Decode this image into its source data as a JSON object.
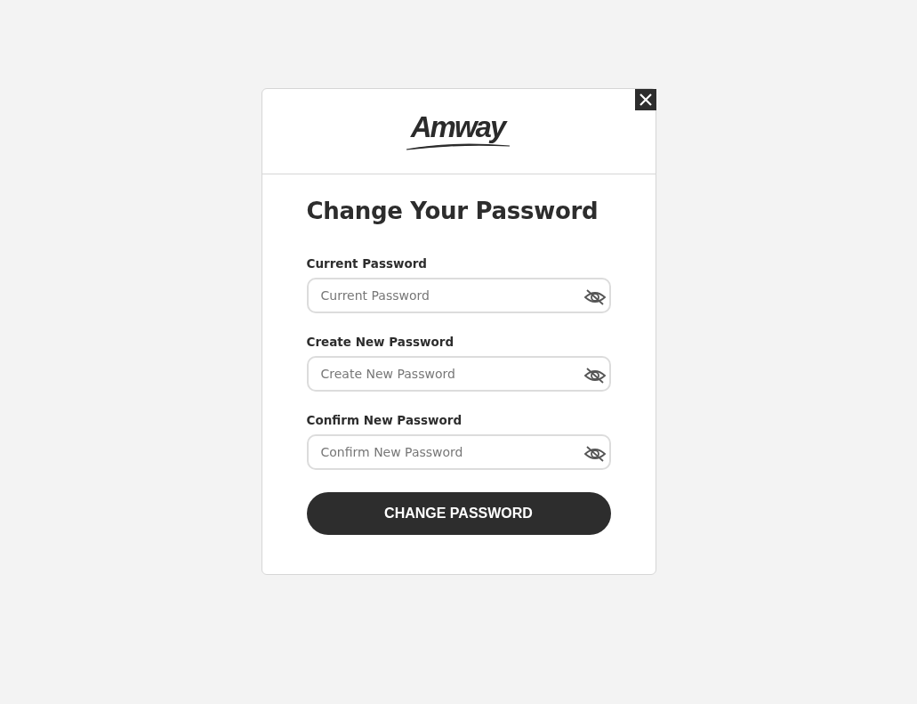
{
  "logo": {
    "text": "Amway"
  },
  "title": "Change Your Password",
  "fields": [
    {
      "label": "Current Password",
      "placeholder": "Current Password"
    },
    {
      "label": "Create New Password",
      "placeholder": "Create New Password"
    },
    {
      "label": "Confirm New Password",
      "placeholder": "Confirm New Password"
    }
  ],
  "submit": "CHANGE PASSWORD"
}
